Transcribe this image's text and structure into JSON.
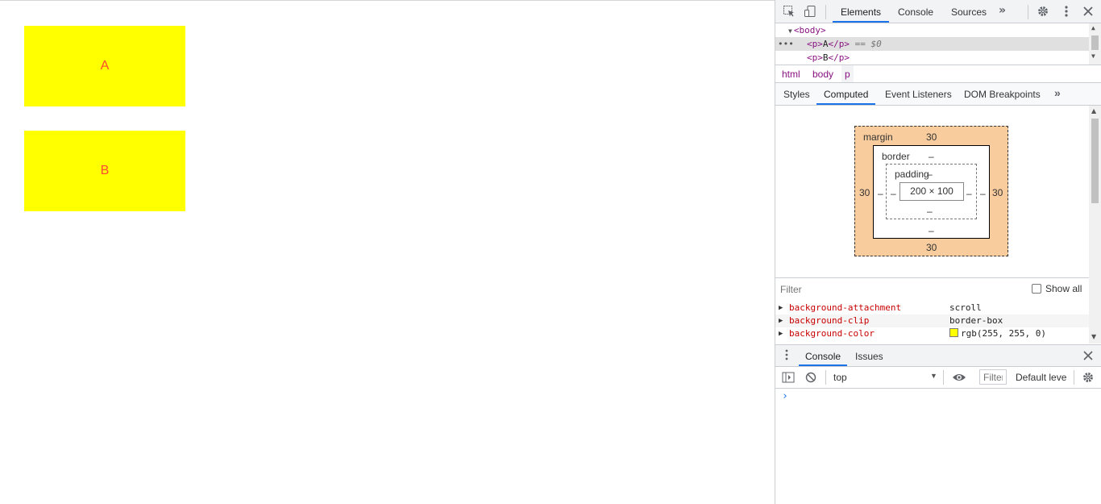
{
  "page": {
    "boxes": [
      {
        "label": "A"
      },
      {
        "label": "B"
      }
    ]
  },
  "devtools": {
    "main_tabs": [
      "Elements",
      "Console",
      "Sources"
    ],
    "elements_tree": {
      "body_open": "<body>",
      "row_selected": {
        "open": "<p>",
        "text": "A",
        "close": "</p>",
        "annotation": "== $0"
      },
      "row_next": {
        "open": "<p>",
        "text": "B",
        "close": "</p>"
      }
    },
    "breadcrumbs": [
      "html",
      "body",
      "p"
    ],
    "sub_tabs": [
      "Styles",
      "Computed",
      "Event Listeners",
      "DOM Breakpoints"
    ],
    "box_model": {
      "margin_label": "margin",
      "margin_top": "30",
      "margin_bottom": "30",
      "margin_left": "30",
      "margin_right": "30",
      "border_label": "border",
      "border_value": "–",
      "padding_label": "padding",
      "padding_value": "–",
      "content": "200 × 100"
    },
    "filter": {
      "placeholder": "Filter",
      "show_all_label": "Show all"
    },
    "properties": [
      {
        "name": "background-attachment",
        "value": "scroll"
      },
      {
        "name": "background-clip",
        "value": "border-box"
      },
      {
        "name": "background-color",
        "value": "rgb(255, 255, 0)"
      }
    ],
    "drawer_tabs": [
      "Console",
      "Issues"
    ],
    "console_toolbar": {
      "context": "top",
      "filter_placeholder": "Filter",
      "levels": "Default leve"
    },
    "prompt": "›"
  }
}
